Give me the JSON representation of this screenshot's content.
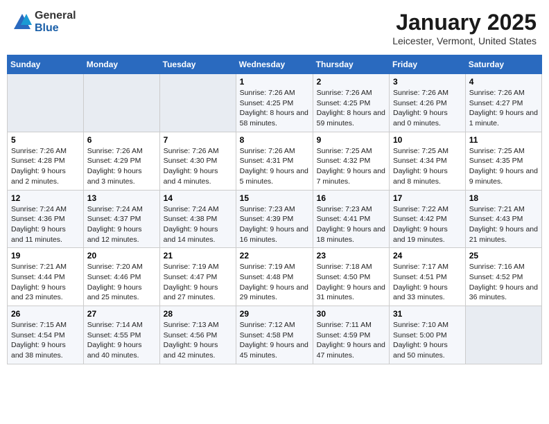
{
  "logo": {
    "general": "General",
    "blue": "Blue"
  },
  "title": "January 2025",
  "subtitle": "Leicester, Vermont, United States",
  "header_days": [
    "Sunday",
    "Monday",
    "Tuesday",
    "Wednesday",
    "Thursday",
    "Friday",
    "Saturday"
  ],
  "weeks": [
    [
      {
        "day": "",
        "empty": true
      },
      {
        "day": "",
        "empty": true
      },
      {
        "day": "",
        "empty": true
      },
      {
        "day": "1",
        "rise": "7:26 AM",
        "set": "4:25 PM",
        "daylight": "8 hours and 58 minutes."
      },
      {
        "day": "2",
        "rise": "7:26 AM",
        "set": "4:25 PM",
        "daylight": "8 hours and 59 minutes."
      },
      {
        "day": "3",
        "rise": "7:26 AM",
        "set": "4:26 PM",
        "daylight": "9 hours and 0 minutes."
      },
      {
        "day": "4",
        "rise": "7:26 AM",
        "set": "4:27 PM",
        "daylight": "9 hours and 1 minute."
      }
    ],
    [
      {
        "day": "5",
        "rise": "7:26 AM",
        "set": "4:28 PM",
        "daylight": "9 hours and 2 minutes."
      },
      {
        "day": "6",
        "rise": "7:26 AM",
        "set": "4:29 PM",
        "daylight": "9 hours and 3 minutes."
      },
      {
        "day": "7",
        "rise": "7:26 AM",
        "set": "4:30 PM",
        "daylight": "9 hours and 4 minutes."
      },
      {
        "day": "8",
        "rise": "7:26 AM",
        "set": "4:31 PM",
        "daylight": "9 hours and 5 minutes."
      },
      {
        "day": "9",
        "rise": "7:25 AM",
        "set": "4:32 PM",
        "daylight": "9 hours and 7 minutes."
      },
      {
        "day": "10",
        "rise": "7:25 AM",
        "set": "4:34 PM",
        "daylight": "9 hours and 8 minutes."
      },
      {
        "day": "11",
        "rise": "7:25 AM",
        "set": "4:35 PM",
        "daylight": "9 hours and 9 minutes."
      }
    ],
    [
      {
        "day": "12",
        "rise": "7:24 AM",
        "set": "4:36 PM",
        "daylight": "9 hours and 11 minutes."
      },
      {
        "day": "13",
        "rise": "7:24 AM",
        "set": "4:37 PM",
        "daylight": "9 hours and 12 minutes."
      },
      {
        "day": "14",
        "rise": "7:24 AM",
        "set": "4:38 PM",
        "daylight": "9 hours and 14 minutes."
      },
      {
        "day": "15",
        "rise": "7:23 AM",
        "set": "4:39 PM",
        "daylight": "9 hours and 16 minutes."
      },
      {
        "day": "16",
        "rise": "7:23 AM",
        "set": "4:41 PM",
        "daylight": "9 hours and 18 minutes."
      },
      {
        "day": "17",
        "rise": "7:22 AM",
        "set": "4:42 PM",
        "daylight": "9 hours and 19 minutes."
      },
      {
        "day": "18",
        "rise": "7:21 AM",
        "set": "4:43 PM",
        "daylight": "9 hours and 21 minutes."
      }
    ],
    [
      {
        "day": "19",
        "rise": "7:21 AM",
        "set": "4:44 PM",
        "daylight": "9 hours and 23 minutes."
      },
      {
        "day": "20",
        "rise": "7:20 AM",
        "set": "4:46 PM",
        "daylight": "9 hours and 25 minutes."
      },
      {
        "day": "21",
        "rise": "7:19 AM",
        "set": "4:47 PM",
        "daylight": "9 hours and 27 minutes."
      },
      {
        "day": "22",
        "rise": "7:19 AM",
        "set": "4:48 PM",
        "daylight": "9 hours and 29 minutes."
      },
      {
        "day": "23",
        "rise": "7:18 AM",
        "set": "4:50 PM",
        "daylight": "9 hours and 31 minutes."
      },
      {
        "day": "24",
        "rise": "7:17 AM",
        "set": "4:51 PM",
        "daylight": "9 hours and 33 minutes."
      },
      {
        "day": "25",
        "rise": "7:16 AM",
        "set": "4:52 PM",
        "daylight": "9 hours and 36 minutes."
      }
    ],
    [
      {
        "day": "26",
        "rise": "7:15 AM",
        "set": "4:54 PM",
        "daylight": "9 hours and 38 minutes."
      },
      {
        "day": "27",
        "rise": "7:14 AM",
        "set": "4:55 PM",
        "daylight": "9 hours and 40 minutes."
      },
      {
        "day": "28",
        "rise": "7:13 AM",
        "set": "4:56 PM",
        "daylight": "9 hours and 42 minutes."
      },
      {
        "day": "29",
        "rise": "7:12 AM",
        "set": "4:58 PM",
        "daylight": "9 hours and 45 minutes."
      },
      {
        "day": "30",
        "rise": "7:11 AM",
        "set": "4:59 PM",
        "daylight": "9 hours and 47 minutes."
      },
      {
        "day": "31",
        "rise": "7:10 AM",
        "set": "5:00 PM",
        "daylight": "9 hours and 50 minutes."
      },
      {
        "day": "",
        "empty": true
      }
    ]
  ],
  "labels": {
    "sunrise": "Sunrise:",
    "sunset": "Sunset:",
    "daylight": "Daylight:"
  }
}
